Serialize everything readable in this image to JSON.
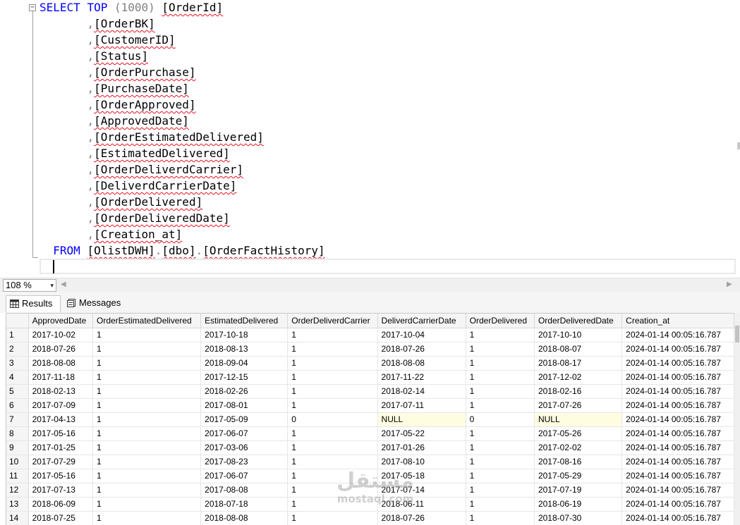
{
  "editor": {
    "fold_glyph": "−",
    "select_keyword": "SELECT",
    "top_keyword": "TOP",
    "top_value": "(1000)",
    "first_column": "[OrderId]",
    "comma": ",",
    "columns": [
      "[OrderBK]",
      "[CustomerID]",
      "[Status]",
      "[OrderPurchase]",
      "[PurchaseDate]",
      "[OrderApproved]",
      "[ApprovedDate]",
      "[OrderEstimatedDelivered]",
      "[EstimatedDelivered]",
      "[OrderDeliverdCarrier]",
      "[DeliverdCarrierDate]",
      "[OrderDelivered]",
      "[OrderDeliveredDate]",
      "[Creation_at]"
    ],
    "from_keyword": "FROM",
    "table_db": "[OlistDWH]",
    "table_schema": "[dbo]",
    "table_name": "[OrderFactHistory]",
    "dot": "."
  },
  "zoom": {
    "value": "108 %",
    "arrow": "▾",
    "scroll_left": "◀",
    "scroll_right": "▶"
  },
  "tabs": {
    "results": "Results",
    "messages": "Messages"
  },
  "grid": {
    "columns": [
      "ApprovedDate",
      "OrderEstimatedDelivered",
      "EstimatedDelivered",
      "OrderDeliverdCarrier",
      "DeliverdCarrierDate",
      "OrderDelivered",
      "OrderDeliveredDate",
      "Creation_at"
    ],
    "rows": [
      {
        "n": "1",
        "cells": [
          "2017-10-02",
          "1",
          "2017-10-18",
          "1",
          "2017-10-04",
          "1",
          "2017-10-10",
          "2024-01-14 00:05:16.787"
        ]
      },
      {
        "n": "2",
        "cells": [
          "2018-07-26",
          "1",
          "2018-08-13",
          "1",
          "2018-07-26",
          "1",
          "2018-08-07",
          "2024-01-14 00:05:16.787"
        ]
      },
      {
        "n": "3",
        "cells": [
          "2018-08-08",
          "1",
          "2018-09-04",
          "1",
          "2018-08-08",
          "1",
          "2018-08-17",
          "2024-01-14 00:05:16.787"
        ]
      },
      {
        "n": "4",
        "cells": [
          "2017-11-18",
          "1",
          "2017-12-15",
          "1",
          "2017-11-22",
          "1",
          "2017-12-02",
          "2024-01-14 00:05:16.787"
        ]
      },
      {
        "n": "5",
        "cells": [
          "2018-02-13",
          "1",
          "2018-02-26",
          "1",
          "2018-02-14",
          "1",
          "2018-02-16",
          "2024-01-14 00:05:16.787"
        ]
      },
      {
        "n": "6",
        "cells": [
          "2017-07-09",
          "1",
          "2017-08-01",
          "1",
          "2017-07-11",
          "1",
          "2017-07-26",
          "2024-01-14 00:05:16.787"
        ]
      },
      {
        "n": "7",
        "cells": [
          "2017-04-13",
          "1",
          "2017-05-09",
          "0",
          "NULL",
          "0",
          "NULL",
          "2024-01-14 00:05:16.787"
        ]
      },
      {
        "n": "8",
        "cells": [
          "2017-05-16",
          "1",
          "2017-06-07",
          "1",
          "2017-05-22",
          "1",
          "2017-05-26",
          "2024-01-14 00:05:16.787"
        ]
      },
      {
        "n": "9",
        "cells": [
          "2017-01-25",
          "1",
          "2017-03-06",
          "1",
          "2017-01-26",
          "1",
          "2017-02-02",
          "2024-01-14 00:05:16.787"
        ]
      },
      {
        "n": "10",
        "cells": [
          "2017-07-29",
          "1",
          "2017-08-23",
          "1",
          "2017-08-10",
          "1",
          "2017-08-16",
          "2024-01-14 00:05:16.787"
        ]
      },
      {
        "n": "11",
        "cells": [
          "2017-05-16",
          "1",
          "2017-06-07",
          "1",
          "2017-05-18",
          "1",
          "2017-05-29",
          "2024-01-14 00:05:16.787"
        ]
      },
      {
        "n": "12",
        "cells": [
          "2017-07-13",
          "1",
          "2017-08-08",
          "1",
          "2017-07-14",
          "1",
          "2017-07-19",
          "2024-01-14 00:05:16.787"
        ]
      },
      {
        "n": "13",
        "cells": [
          "2018-06-09",
          "1",
          "2018-07-18",
          "1",
          "2018-06-11",
          "1",
          "2018-06-19",
          "2024-01-14 00:05:16.787"
        ]
      },
      {
        "n": "14",
        "cells": [
          "2018-07-25",
          "1",
          "2018-08-08",
          "1",
          "2018-07-26",
          "1",
          "2018-07-30",
          "2024-01-14 00:05:16.787"
        ]
      }
    ]
  },
  "watermark": {
    "arabic": "مستقل",
    "latin": "mostaql.com"
  },
  "colors": {
    "keyword": "#0000ff",
    "punctuation": "#808080",
    "squiggle": "#e81123",
    "null_cell": "#fffde1"
  }
}
